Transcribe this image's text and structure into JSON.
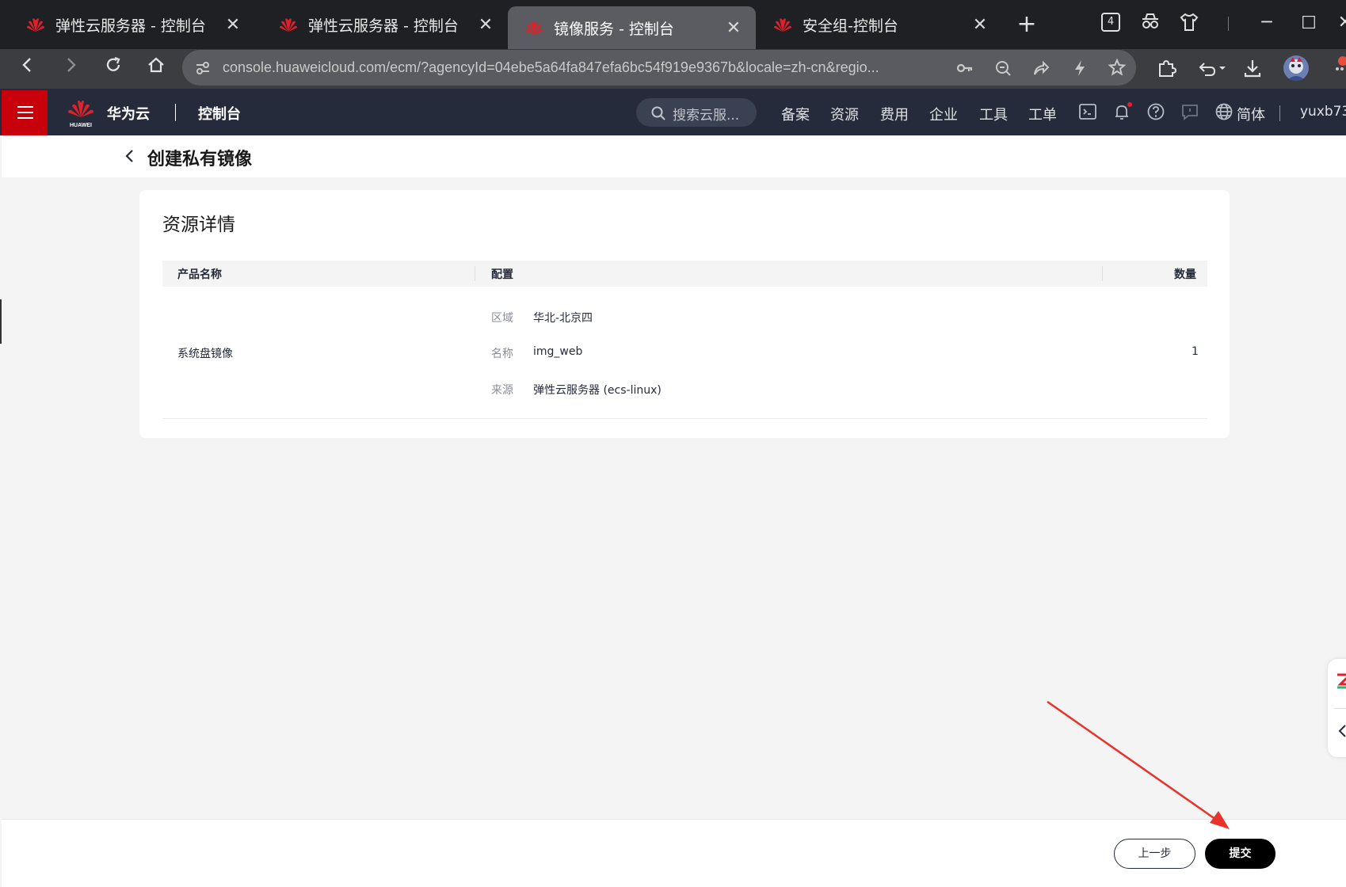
{
  "browser": {
    "tabs": [
      {
        "title": "弹性云服务器 - 控制台",
        "active": false
      },
      {
        "title": "弹性云服务器 - 控制台",
        "active": false
      },
      {
        "title": "镜像服务 - 控制台",
        "active": true
      },
      {
        "title": "安全组-控制台",
        "active": false
      }
    ],
    "new_tab": "+",
    "tab_count": "4",
    "url": "console.huaweicloud.com/ecm/?agencyId=04ebe5a64fa847efa6bc54f919e9367b&locale=zh-cn&regio..."
  },
  "header": {
    "brand": "华为云",
    "brand_sub": "HUAWEI",
    "console": "控制台",
    "search_placeholder": "搜索云服...",
    "nav": [
      "备案",
      "资源",
      "费用",
      "企业",
      "工具",
      "工单"
    ],
    "language": "简体",
    "user": "yuxb73"
  },
  "page": {
    "title": "创建私有镜像"
  },
  "resource_details": {
    "title": "资源详情",
    "columns": [
      "产品名称",
      "配置",
      "数量"
    ],
    "row": {
      "product": "系统盘镜像",
      "config": [
        {
          "label": "区域",
          "value": "华北-北京四"
        },
        {
          "label": "名称",
          "value": "img_web"
        },
        {
          "label": "来源",
          "value": "弹性云服务器 (ecs-linux)"
        }
      ],
      "quantity": "1"
    }
  },
  "footer": {
    "prev_label": "上一步",
    "submit_label": "提交"
  },
  "colors": {
    "brand_red": "#c7000b",
    "header_bg": "#252b3a",
    "annotation_arrow": "#e8322c"
  }
}
